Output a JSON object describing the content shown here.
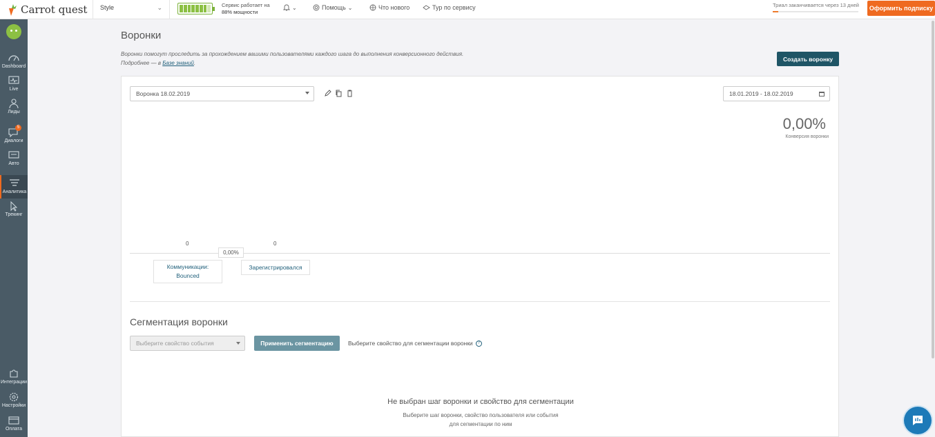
{
  "header": {
    "logo_text": "Carrot quest",
    "project": "Style",
    "service_line1": "Сервис работает на",
    "service_line2": "88% мощности",
    "service_capacity_fraction": 0.88,
    "nav": [
      {
        "label": "Помощь"
      },
      {
        "label": "Что нового"
      },
      {
        "label": "Тур по сервису"
      }
    ],
    "trial_text": "Триал заканчивается через 13 дней",
    "subscribe_label": "Оформить подписку",
    "accent_color": "#ef6a20"
  },
  "sidebar": {
    "items": [
      {
        "label": "Dashboard",
        "icon": "dashboard-icon"
      },
      {
        "label": "Live",
        "icon": "live-icon"
      },
      {
        "label": "Лиды",
        "icon": "leads-icon"
      },
      {
        "label": "Диалоги",
        "icon": "dialogs-icon",
        "badge": "5"
      },
      {
        "label": "Авто",
        "icon": "auto-icon"
      },
      {
        "label": "Аналитика",
        "icon": "analytics-icon",
        "active": true
      },
      {
        "label": "Трекинг",
        "icon": "tracking-icon"
      },
      {
        "label": "Интеграции",
        "icon": "integrations-icon"
      },
      {
        "label": "Настройки",
        "icon": "settings-icon"
      },
      {
        "label": "Оплата",
        "icon": "payment-icon"
      }
    ]
  },
  "page": {
    "title": "Воронки",
    "desc_line1": "Воронки помогут проследить за прохождением вашими пользователями каждого шага до выполнения конверсионного действия.",
    "desc_line2_prefix": "Подробнее — в ",
    "desc_link": "Базе знаний",
    "desc_line2_suffix": ".",
    "create_button": "Создать воронку"
  },
  "funnel": {
    "selected": "Воронка 18.02.2019",
    "date_range": "18.01.2019 - 18.02.2019",
    "conversion_value": "0,00%",
    "conversion_label": "Конверсия воронки",
    "steps": [
      {
        "count": "0",
        "label": "Коммуникации: Bounced"
      },
      {
        "count": "0",
        "label": "Зарегистрировался"
      }
    ],
    "step_conversion": "0,00%"
  },
  "segmentation": {
    "title": "Сегментация воронки",
    "select_placeholder": "Выберите свойство события",
    "apply_button": "Применить сегментацию",
    "hint": "Выберите свойство для сегментации воронки",
    "empty_title": "Не выбран шаг воронки и свойство для сегментации",
    "empty_sub1": "Выберите шаг воронки, свойство пользователя или события",
    "empty_sub2": "для сегментации по ним"
  }
}
